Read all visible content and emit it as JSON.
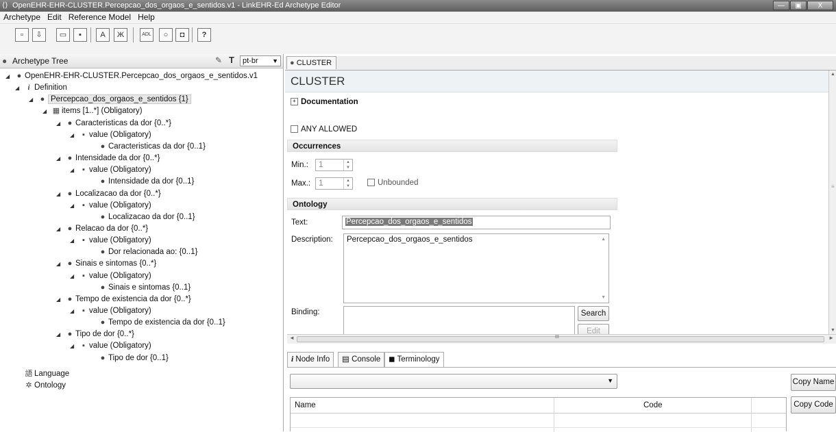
{
  "window": {
    "title": "OpenEHR-EHR-CLUSTER.Percepcao_dos_orgaos_e_sentidos.v1 - LinkEHR-Ed Archetype Editor",
    "minimize": "—",
    "maximize": "▣",
    "close": "X"
  },
  "menu": [
    "Archetype",
    "Edit",
    "Reference Model",
    "Help"
  ],
  "toolbar": {
    "buttons": [
      {
        "icon": "new-archetype-icon",
        "glyph": "▫"
      },
      {
        "icon": "import-icon",
        "glyph": "⇩"
      },
      {
        "icon": "open-folder-icon",
        "glyph": "▭"
      },
      {
        "icon": "save-icon",
        "glyph": "▪"
      },
      {
        "icon": "validate-icon",
        "glyph": "A"
      },
      {
        "icon": "spellcheck-icon",
        "glyph": "Ж"
      },
      {
        "icon": "adl-icon",
        "glyph": "ADL"
      },
      {
        "icon": "search-icon",
        "glyph": "○"
      },
      {
        "icon": "view-icon",
        "glyph": "◘"
      },
      {
        "icon": "help-icon",
        "glyph": "?"
      }
    ]
  },
  "left_panel": {
    "title": "Archetype Tree",
    "language": "pt-br",
    "tree": [
      {
        "level": 0,
        "arrow": "◢",
        "icon": "●",
        "label": "OpenEHR-EHR-CLUSTER.Percepcao_dos_orgaos_e_sentidos.v1"
      },
      {
        "level": 1,
        "arrow": "◢",
        "icon": "i",
        "label": "Definition"
      },
      {
        "level": 2,
        "arrow": "◢",
        "icon": "●",
        "label": "Percepcao_dos_orgaos_e_sentidos {1}",
        "selected": true
      },
      {
        "level": 3,
        "arrow": "◢",
        "icon": "▦",
        "label": "items [1..*] (Obligatory)"
      },
      {
        "level": 4,
        "arrow": "◢",
        "icon": "●",
        "label": "Caracteristicas da dor {0..*}"
      },
      {
        "level": 5,
        "arrow": "◢",
        "icon": "▪",
        "label": "value (Obligatory)"
      },
      {
        "level": 6,
        "arrow": "",
        "icon": "●",
        "label": "Caracteristicas da dor {0..1}"
      },
      {
        "level": 4,
        "arrow": "◢",
        "icon": "●",
        "label": "Intensidade da dor {0..*}"
      },
      {
        "level": 5,
        "arrow": "◢",
        "icon": "▪",
        "label": "value (Obligatory)"
      },
      {
        "level": 6,
        "arrow": "",
        "icon": "●",
        "label": "Intensidade da dor {0..1}"
      },
      {
        "level": 4,
        "arrow": "◢",
        "icon": "●",
        "label": "Localizacao da dor {0..*}"
      },
      {
        "level": 5,
        "arrow": "◢",
        "icon": "▪",
        "label": "value (Obligatory)"
      },
      {
        "level": 6,
        "arrow": "",
        "icon": "●",
        "label": "Localizacao da dor {0..1}"
      },
      {
        "level": 4,
        "arrow": "◢",
        "icon": "●",
        "label": "Relacao da dor {0..*}"
      },
      {
        "level": 5,
        "arrow": "◢",
        "icon": "▪",
        "label": "value (Obligatory)"
      },
      {
        "level": 6,
        "arrow": "",
        "icon": "●",
        "label": "Dor relacionada ao: {0..1}"
      },
      {
        "level": 4,
        "arrow": "◢",
        "icon": "●",
        "label": "Sinais e sintomas {0..*}"
      },
      {
        "level": 5,
        "arrow": "◢",
        "icon": "▪",
        "label": "value (Obligatory)"
      },
      {
        "level": 6,
        "arrow": "",
        "icon": "●",
        "label": "Sinais e sintomas {0..1}"
      },
      {
        "level": 4,
        "arrow": "◢",
        "icon": "●",
        "label": "Tempo de existencia da dor {0..*}"
      },
      {
        "level": 5,
        "arrow": "◢",
        "icon": "▪",
        "label": "value (Obligatory)"
      },
      {
        "level": 6,
        "arrow": "",
        "icon": "●",
        "label": "Tempo de existencia da dor {0..1}"
      },
      {
        "level": 4,
        "arrow": "◢",
        "icon": "●",
        "label": "Tipo de dor {0..*}"
      },
      {
        "level": 5,
        "arrow": "◢",
        "icon": "▪",
        "label": "value (Obligatory)"
      },
      {
        "level": 6,
        "arrow": "",
        "icon": "●",
        "label": "Tipo de dor {0..1}"
      },
      {
        "level": 1,
        "arrow": "",
        "icon": "語",
        "label": "Language"
      },
      {
        "level": 1,
        "arrow": "",
        "icon": "✲",
        "label": "Ontology"
      }
    ]
  },
  "editor": {
    "tab": "CLUSTER",
    "heading": "CLUSTER",
    "documentation": "Documentation",
    "any_allowed": "ANY ALLOWED",
    "occurrences": {
      "section": "Occurrences",
      "min_label": "Min.:",
      "min_value": "1",
      "max_label": "Max.:",
      "max_value": "1",
      "unbounded": "Unbounded"
    },
    "ontology": {
      "section": "Ontology",
      "text_label": "Text:",
      "text_value": "Percepcao_dos_orgaos_e_sentidos",
      "description_label": "Description:",
      "description_value": "Percepcao_dos_orgaos_e_sentidos",
      "binding_label": "Binding:",
      "search_button": "Search",
      "edit_button": "Edit"
    },
    "scroll_mark": "III"
  },
  "bottom": {
    "tabs": [
      {
        "icon": "info-icon",
        "glyph": "i",
        "label": "Node Info"
      },
      {
        "icon": "console-icon",
        "glyph": "▤",
        "label": "Console"
      },
      {
        "icon": "terminology-icon",
        "glyph": "◼",
        "label": "Terminology"
      }
    ],
    "copy_name": "Copy Name",
    "copy_code": "Copy Code",
    "columns": [
      "Name",
      "Code"
    ]
  }
}
